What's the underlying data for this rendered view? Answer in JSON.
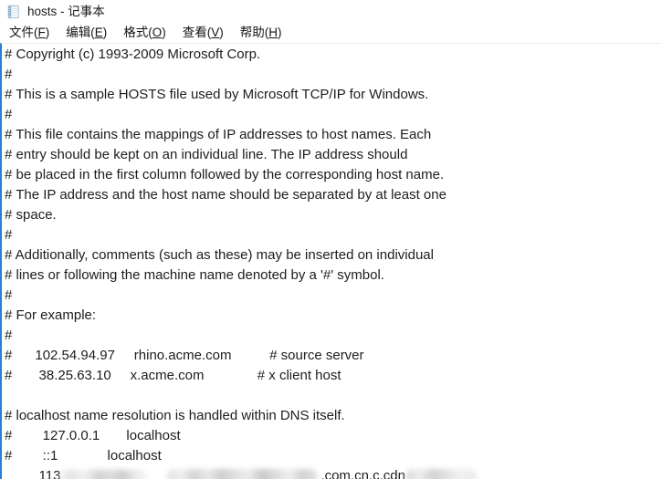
{
  "window": {
    "title": "hosts - 记事本",
    "icon": "notepad-document-icon"
  },
  "menu": {
    "items": [
      {
        "label": "文件",
        "mnemonic": "F",
        "accel": "(F)"
      },
      {
        "label": "编辑",
        "mnemonic": "E",
        "accel": "(E)"
      },
      {
        "label": "格式",
        "mnemonic": "O",
        "accel": "(O)"
      },
      {
        "label": "查看",
        "mnemonic": "V",
        "accel": "(V)"
      },
      {
        "label": "帮助",
        "mnemonic": "H",
        "accel": "(H)"
      }
    ]
  },
  "editor": {
    "lines": [
      "# Copyright (c) 1993-2009 Microsoft Corp.",
      "#",
      "# This is a sample HOSTS file used by Microsoft TCP/IP for Windows.",
      "#",
      "# This file contains the mappings of IP addresses to host names. Each",
      "# entry should be kept on an individual line. The IP address should",
      "# be placed in the first column followed by the corresponding host name.",
      "# The IP address and the host name should be separated by at least one",
      "# space.",
      "#",
      "# Additionally, comments (such as these) may be inserted on individual",
      "# lines or following the machine name denoted by a '#' symbol.",
      "#",
      "# For example:",
      "#",
      "#      102.54.94.97     rhino.acme.com          # source server",
      "#       38.25.63.10     x.acme.com              # x client host",
      "",
      "# localhost name resolution is handled within DNS itself.",
      "#        127.0.0.1       localhost",
      "#        ::1             localhost"
    ],
    "redacted_line": {
      "prefix": "         113",
      "visible_middle": ".com.cn.c.cdn",
      "redacted": true
    }
  }
}
